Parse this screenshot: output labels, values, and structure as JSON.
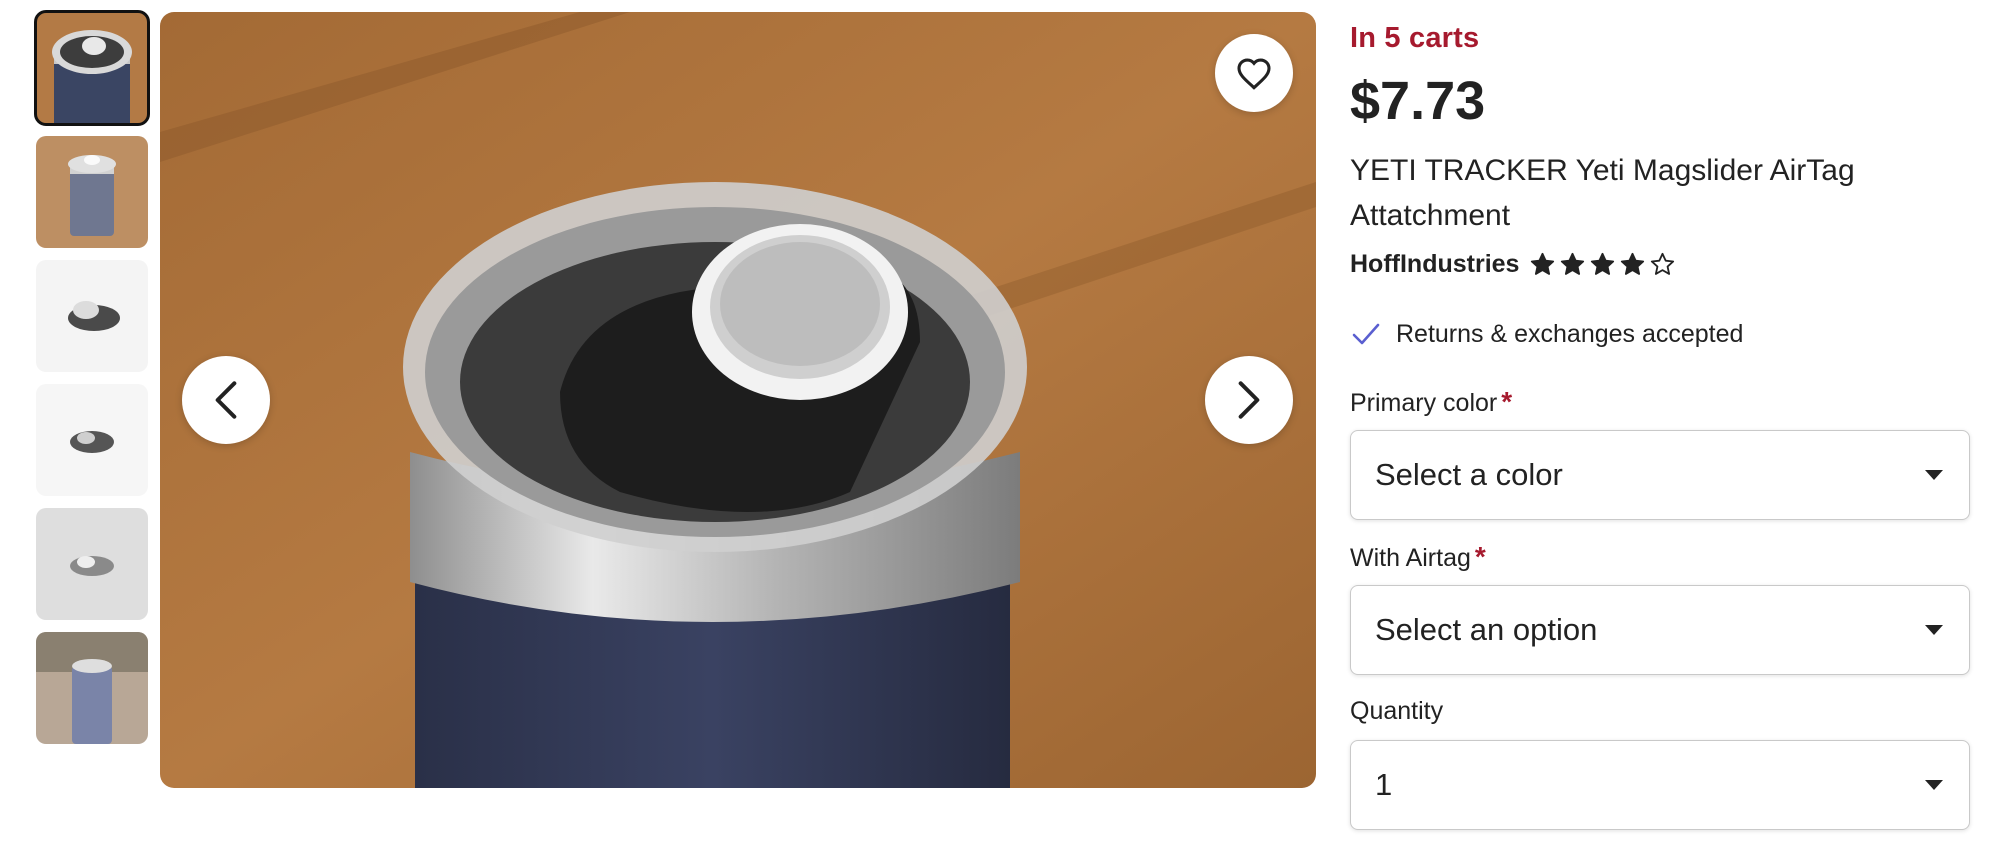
{
  "thumbnails": [
    {
      "name": "thumbnail-1",
      "selected": true
    },
    {
      "name": "thumbnail-2",
      "selected": false
    },
    {
      "name": "thumbnail-3",
      "selected": false
    },
    {
      "name": "thumbnail-4",
      "selected": false
    },
    {
      "name": "thumbnail-5",
      "selected": false
    },
    {
      "name": "thumbnail-6",
      "selected": false
    }
  ],
  "hero": {
    "favorite_icon": "heart-icon",
    "prev_icon": "chevron-left-icon",
    "next_icon": "chevron-right-icon"
  },
  "product": {
    "in_carts": "In 5 carts",
    "price": "$7.73",
    "title": "YETI TRACKER Yeti Magslider AirTag Attatchment",
    "shop_name": "HoffIndustries",
    "rating_stars": 4,
    "rating_max": 5,
    "returns_text": "Returns & exchanges accepted"
  },
  "options": {
    "primary_color": {
      "label": "Primary color",
      "required_mark": "*",
      "value": "Select a color"
    },
    "with_airtag": {
      "label": "With Airtag",
      "required_mark": "*",
      "value": "Select an option"
    },
    "quantity": {
      "label": "Quantity",
      "value": "1"
    }
  },
  "colors": {
    "accent_red": "#a61a2e",
    "check_blue": "#5a5fd0",
    "text": "#222222"
  }
}
